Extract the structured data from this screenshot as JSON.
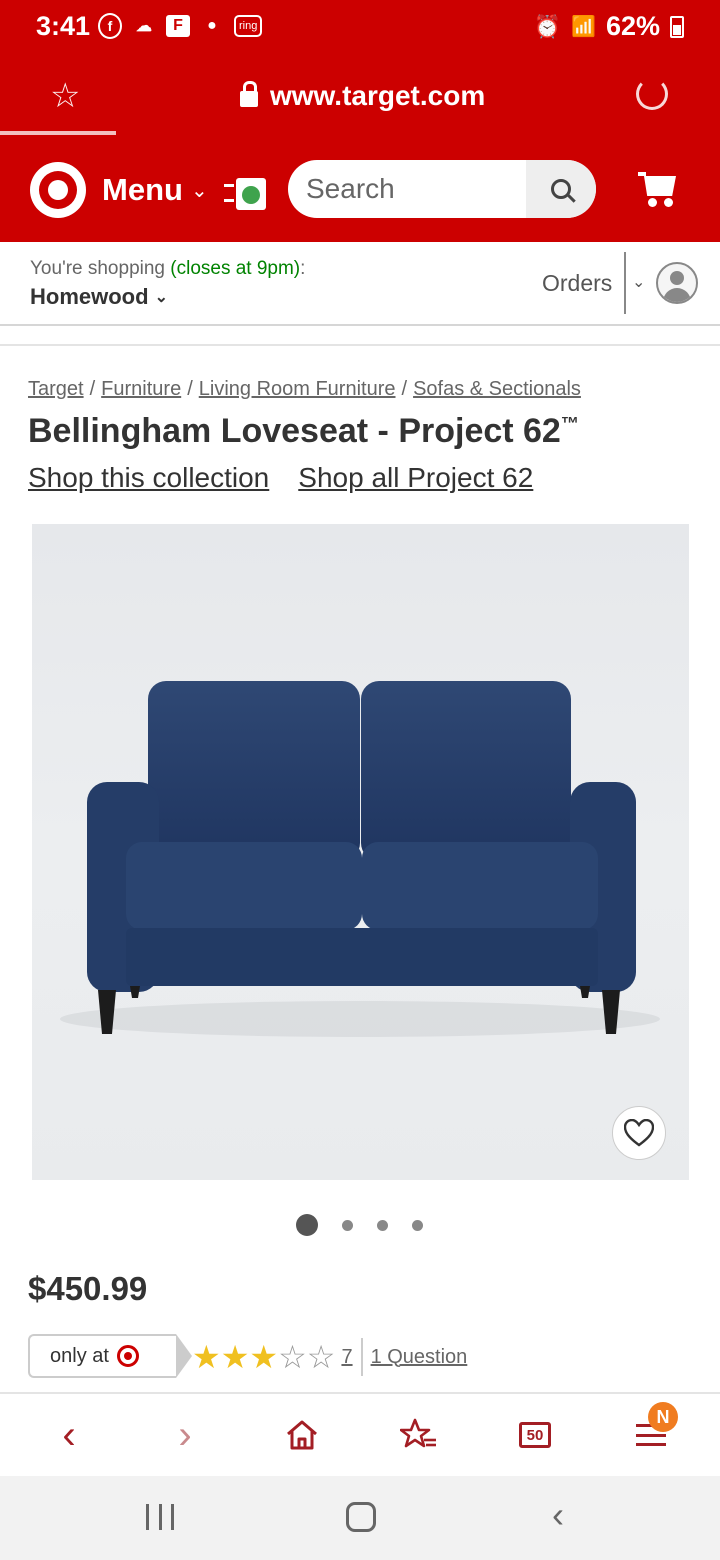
{
  "status_bar": {
    "time": "3:41",
    "left_icons": [
      "facebook-icon",
      "cloud-icon",
      "flipboard-icon",
      "messenger-icon",
      "ring-icon",
      "more-icon"
    ],
    "ring_label": "ring",
    "more": "···",
    "battery": "62%"
  },
  "browser": {
    "url": "www.target.com"
  },
  "header": {
    "menu_label": "Menu",
    "search_placeholder": "Search",
    "brand_color": "#cc0000"
  },
  "store": {
    "prefix": "You're shopping ",
    "closes": "(closes at 9pm)",
    "suffix": ":",
    "name": "Homewood",
    "orders_label": "Orders"
  },
  "breadcrumb": [
    {
      "label": "Target"
    },
    {
      "label": "Furniture"
    },
    {
      "label": "Living Room Furniture"
    },
    {
      "label": "Sofas & Sectionals"
    }
  ],
  "breadcrumb_sep": "/",
  "product": {
    "title": "Bellingham Loveseat - Project 62",
    "title_mark": "™",
    "link_collection": "Shop this collection",
    "link_all": "Shop all Project 62",
    "price": "$450.99",
    "only_at": "only at",
    "rating": 3,
    "rating_max": 5,
    "review_count": "7",
    "question_link": "1 Question",
    "image_count": 4,
    "active_image": 1
  },
  "bottom_nav": {
    "tab_count": "50",
    "badge": "N"
  }
}
